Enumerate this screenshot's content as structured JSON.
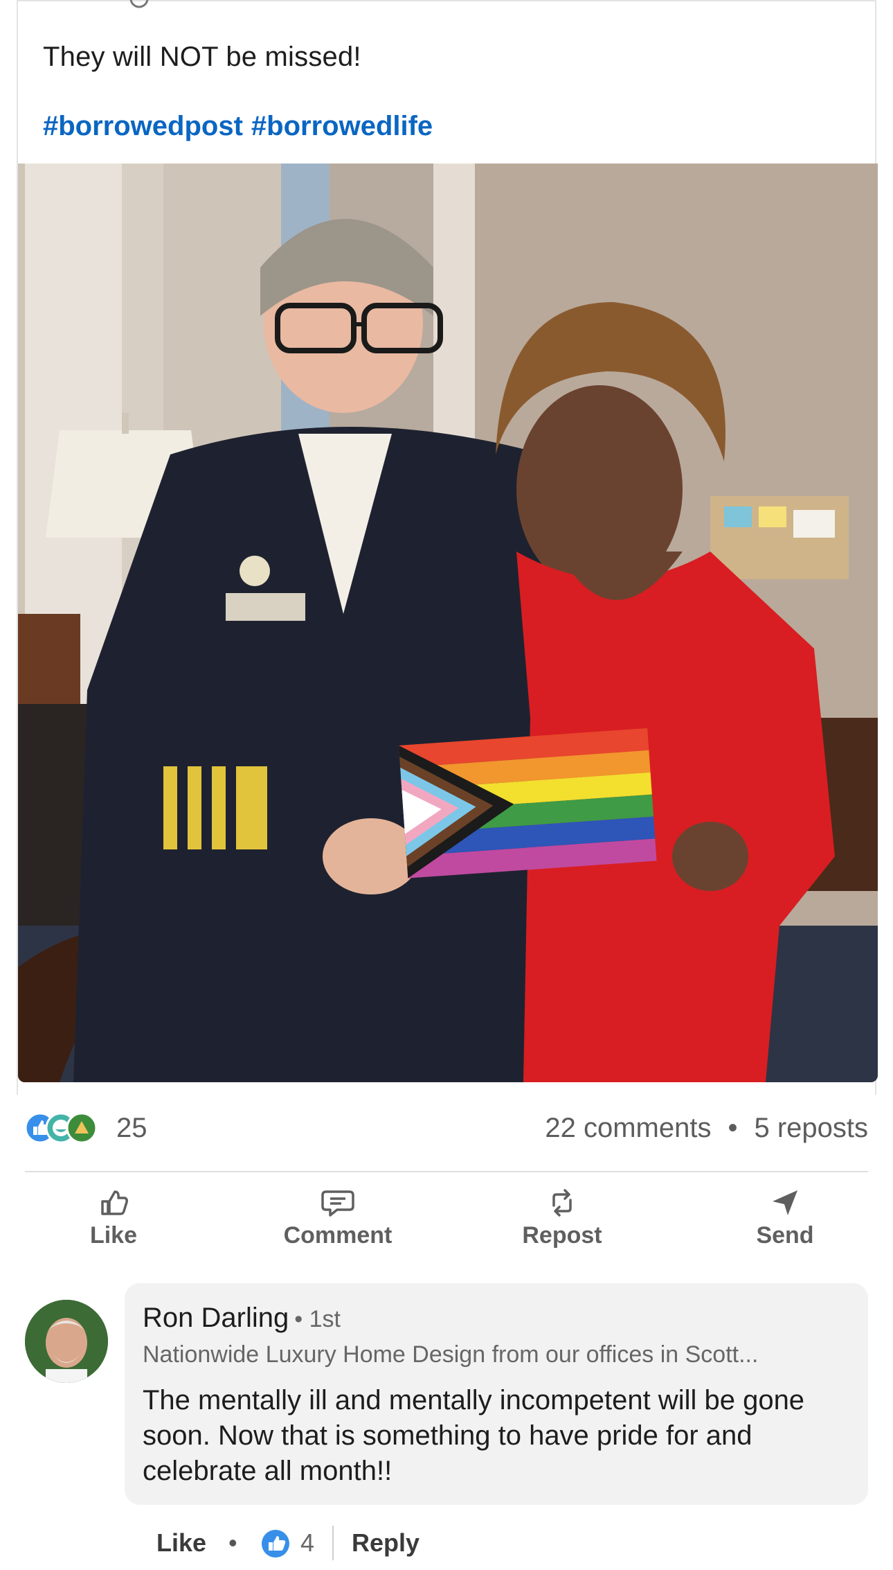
{
  "post": {
    "text": "They will NOT be missed!",
    "hashtags": [
      "#borrowedpost",
      "#borrowedlife"
    ],
    "image": {
      "description_icon": "photo-image"
    }
  },
  "social_counts": {
    "reactions_count": "25",
    "comments": "22 comments",
    "separator": "•",
    "reposts": "5 reposts",
    "reaction_icons": [
      "like-icon",
      "funny-icon",
      "celebrate-icon"
    ]
  },
  "actions": {
    "like": "Like",
    "comment": "Comment",
    "repost": "Repost",
    "send": "Send"
  },
  "comment": {
    "author": "Ron Darling",
    "degree": "• 1st",
    "headline": "Nationwide Luxury Home Design from our offices in Scott...",
    "text": "The mentally ill and mentally incompetent will be gone soon. Now that is something to have pride for and celebrate all month!!",
    "like_label": "Like",
    "dot": "•",
    "reaction_count": "4",
    "reply_label": "Reply"
  },
  "colors": {
    "link_blue": "#0a66c2",
    "like_blue": "#378fe9",
    "bubble_bg": "#f2f2f2"
  }
}
